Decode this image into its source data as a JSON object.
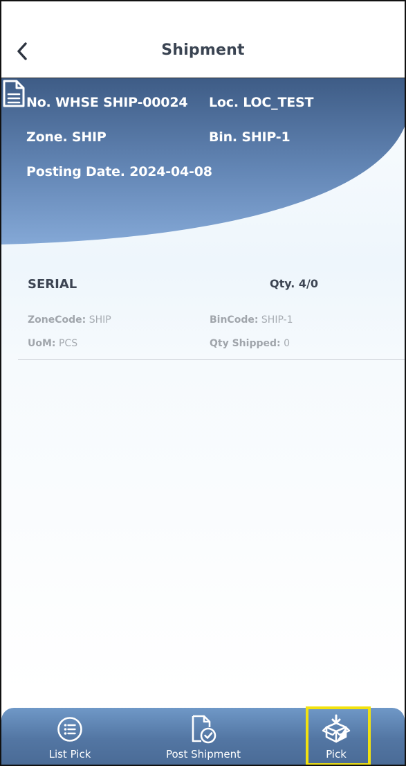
{
  "header": {
    "title": "Shipment",
    "back_icon": "chevron-left-icon"
  },
  "shipment": {
    "no": "No. WHSE SHIP-00024",
    "loc": "Loc. LOC_TEST",
    "zone": "Zone. SHIP",
    "bin": "Bin. SHIP-1",
    "posting_date": "Posting Date. 2024-04-08",
    "doc_icon": "document-icon"
  },
  "lines": [
    {
      "name": "SERIAL",
      "qty": "Qty. 4/0",
      "zone_code_label": "ZoneCode:",
      "zone_code": "SHIP",
      "bin_code_label": "BinCode:",
      "bin_code": "SHIP-1",
      "uom_label": "UoM:",
      "uom": "PCS",
      "qty_shipped_label": "Qty Shipped:",
      "qty_shipped": "0"
    }
  ],
  "bottom_nav": {
    "items": [
      {
        "label": "List Pick",
        "icon": "list-icon"
      },
      {
        "label": "Post Shipment",
        "icon": "post-document-icon"
      },
      {
        "label": "Pick",
        "icon": "box-download-icon"
      }
    ],
    "highlighted_index": 2
  },
  "colors": {
    "banner_dark": "#3e5c86",
    "banner_light": "#7fa3d3",
    "nav_bar": "#5a7eab",
    "highlight": "#f2e20f"
  }
}
